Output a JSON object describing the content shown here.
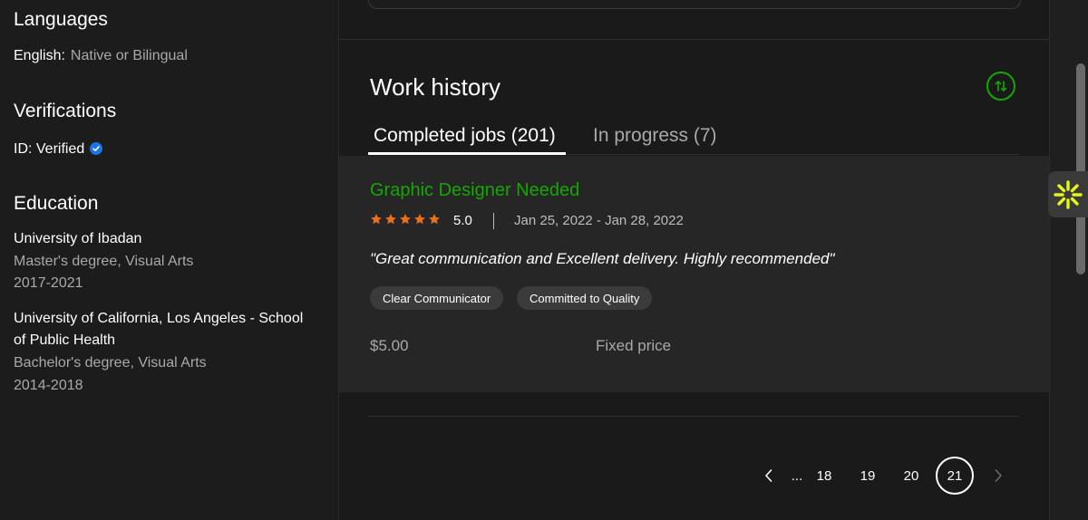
{
  "sidebar": {
    "languages": {
      "heading": "Languages",
      "items": [
        {
          "language": "English:",
          "level": "Native or Bilingual"
        }
      ]
    },
    "verifications": {
      "heading": "Verifications",
      "id_label": "ID: Verified"
    },
    "education": {
      "heading": "Education",
      "items": [
        {
          "school": "University of Ibadan",
          "degree": "Master's degree, Visual Arts",
          "years": "2017-2021"
        },
        {
          "school": "University of California, Los Angeles - School of Public Health",
          "degree": "Bachelor's degree, Visual Arts",
          "years": "2014-2018"
        }
      ]
    }
  },
  "work_history": {
    "title": "Work history",
    "sort_icon": "sort-arrows-icon",
    "tabs": [
      {
        "label": "Completed jobs (201)",
        "active": true
      },
      {
        "label": "In progress (7)",
        "active": false
      }
    ],
    "jobs": [
      {
        "title": "Graphic Designer Needed",
        "rating": "5.0",
        "stars": 5,
        "dates": "Jan 25, 2022 - Jan 28, 2022",
        "feedback": "\"Great communication and Excellent delivery. Highly recommended\"",
        "tags": [
          "Clear Communicator",
          "Committed to Quality"
        ],
        "amount": "$5.00",
        "price_type": "Fixed price"
      }
    ],
    "pagination": {
      "prev_icon": "chevron-left-icon",
      "ellipsis": "...",
      "pages": [
        "18",
        "19",
        "20",
        "21"
      ],
      "current": "21",
      "next_icon": "chevron-right-icon"
    }
  },
  "colors": {
    "accent_green": "#14a800",
    "star_orange": "#e8701a",
    "verified_blue": "#1a73e8",
    "widget_yellow": "#e4f518"
  }
}
